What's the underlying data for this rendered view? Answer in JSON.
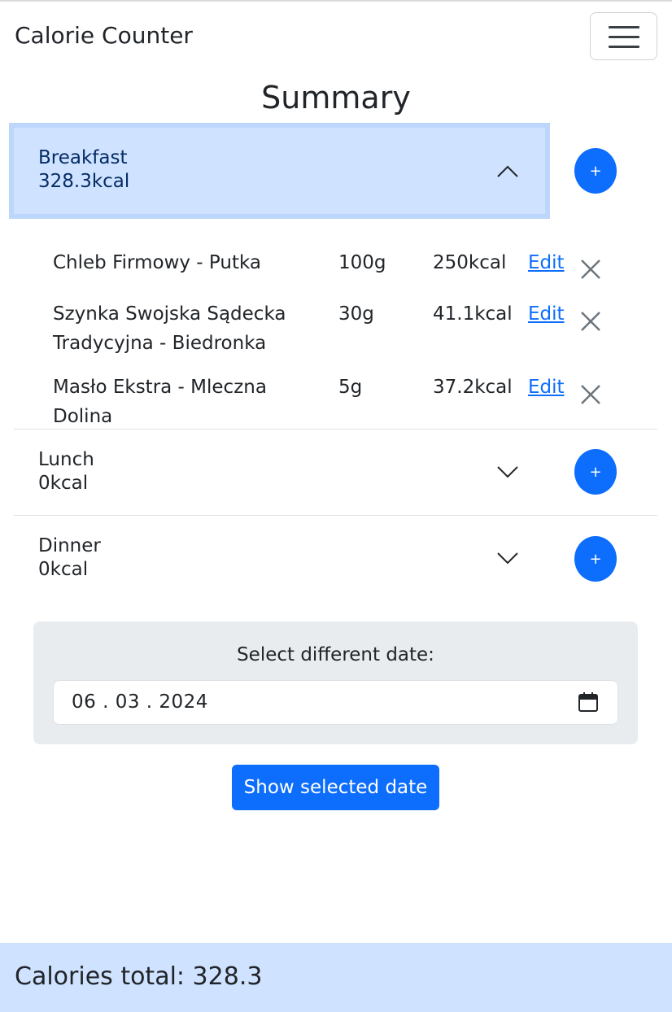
{
  "navbar": {
    "brand": "Calorie Counter",
    "toggler_icon": "hamburger-icon"
  },
  "page": {
    "title": "Summary"
  },
  "meals": [
    {
      "name": "Breakfast",
      "kcal": "328.3kcal",
      "expanded": true,
      "add_label": "+",
      "items": [
        {
          "name": "Chleb Firmowy - Putka",
          "qty": "100g",
          "kcal": "250kcal",
          "edit": "Edit"
        },
        {
          "name": "Szynka Swojska Sądecka Tradycyjna - Biedronka",
          "qty": "30g",
          "kcal": "41.1kcal",
          "edit": "Edit"
        },
        {
          "name": "Masło Ekstra - Mleczna Dolina",
          "qty": "5g",
          "kcal": "37.2kcal",
          "edit": "Edit"
        }
      ]
    },
    {
      "name": "Lunch",
      "kcal": "0kcal",
      "expanded": false,
      "add_label": "+",
      "items": []
    },
    {
      "name": "Dinner",
      "kcal": "0kcal",
      "expanded": false,
      "add_label": "+",
      "items": []
    }
  ],
  "date_picker": {
    "label": "Select different date:",
    "value": "06 . 03 . 2024",
    "icon": "calendar-icon"
  },
  "show_button": {
    "label": "Show selected date"
  },
  "footer": {
    "total_text": "Calories total: 328.3"
  },
  "colors": {
    "primary": "#0d6efd",
    "accordion_active_bg": "#cfe2ff",
    "accordion_active_text": "#052c65",
    "card_bg": "#e9ecef"
  }
}
